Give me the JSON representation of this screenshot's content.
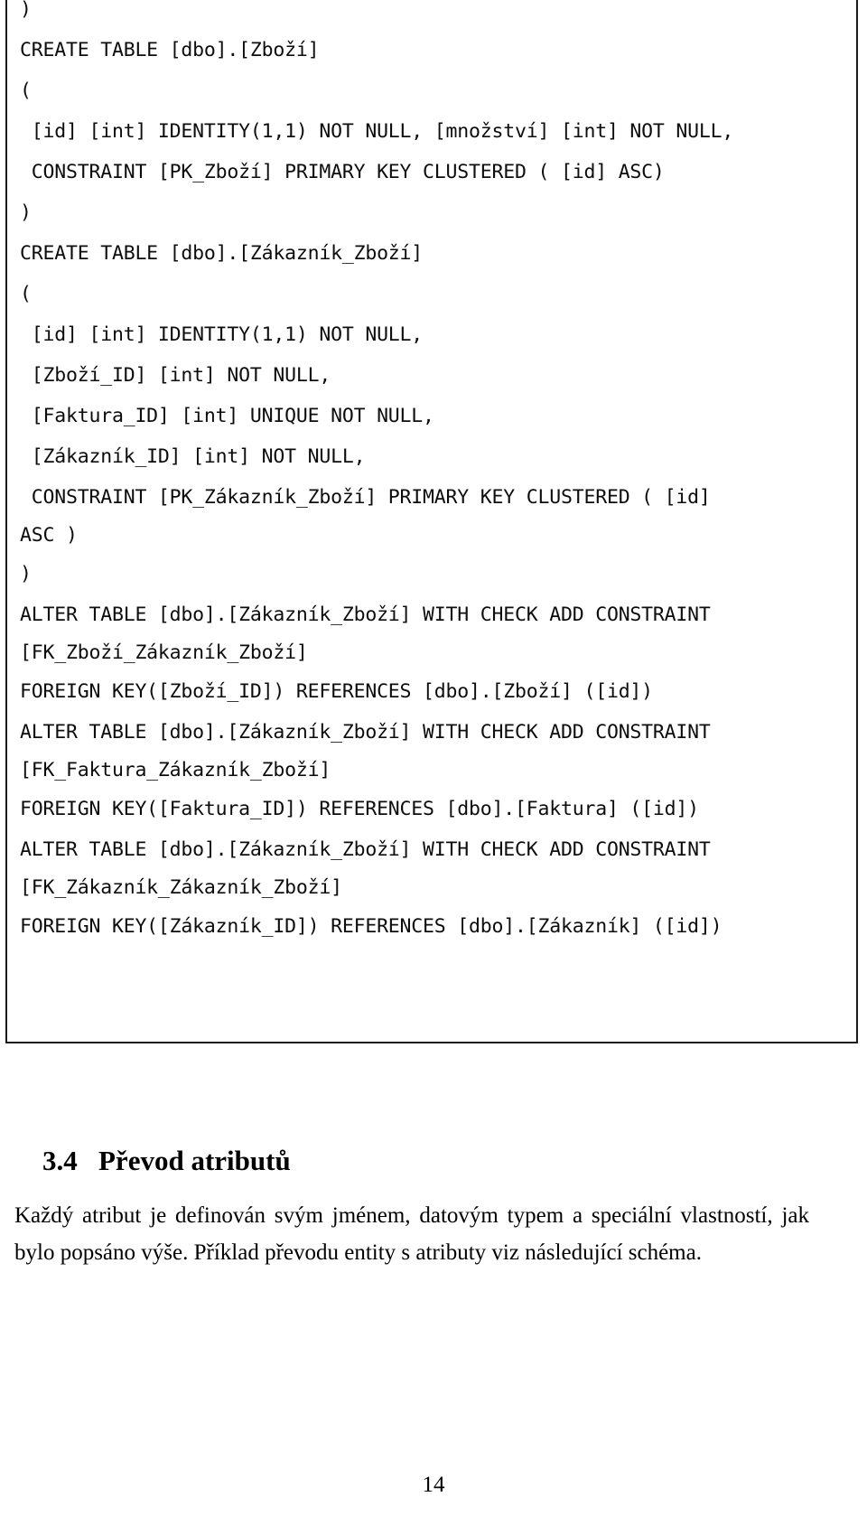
{
  "document": {
    "page_number": "14",
    "language": "cs"
  },
  "code_block": {
    "language": "sql",
    "lines": [
      {
        "text": ")",
        "cont": false
      },
      {
        "text": "CREATE TABLE [dbo].[Zboží]",
        "cont": false
      },
      {
        "text": "(",
        "cont": false
      },
      {
        "text": " [id] [int] IDENTITY(1,1) NOT NULL, [množství] [int] NOT NULL,",
        "cont": false
      },
      {
        "text": " CONSTRAINT [PK_Zboží] PRIMARY KEY CLUSTERED ( [id] ASC)",
        "cont": false
      },
      {
        "text": ")",
        "cont": false
      },
      {
        "text": "CREATE TABLE [dbo].[Zákazník_Zboží]",
        "cont": false
      },
      {
        "text": "(",
        "cont": false
      },
      {
        "text": " [id] [int] IDENTITY(1,1) NOT NULL,",
        "cont": false
      },
      {
        "text": " [Zboží_ID] [int] NOT NULL,",
        "cont": false
      },
      {
        "text": " [Faktura_ID] [int] UNIQUE NOT NULL,",
        "cont": false
      },
      {
        "text": " [Zákazník_ID] [int] NOT NULL,",
        "cont": false
      },
      {
        "text": " CONSTRAINT [PK_Zákazník_Zboží] PRIMARY KEY CLUSTERED ( [id]",
        "cont": false
      },
      {
        "text": "ASC )",
        "cont": true
      },
      {
        "text": ")",
        "cont": false
      },
      {
        "text": "ALTER TABLE [dbo].[Zákazník_Zboží] WITH CHECK ADD CONSTRAINT",
        "cont": false
      },
      {
        "text": "[FK_Zboží_Zákazník_Zboží]",
        "cont": true
      },
      {
        "text": "FOREIGN KEY([Zboží_ID]) REFERENCES [dbo].[Zboží] ([id])",
        "cont": false
      },
      {
        "text": "ALTER TABLE [dbo].[Zákazník_Zboží] WITH CHECK ADD CONSTRAINT",
        "cont": false
      },
      {
        "text": "[FK_Faktura_Zákazník_Zboží]",
        "cont": true
      },
      {
        "text": "FOREIGN KEY([Faktura_ID]) REFERENCES [dbo].[Faktura] ([id])",
        "cont": false
      },
      {
        "text": "ALTER TABLE [dbo].[Zákazník_Zboží] WITH CHECK ADD CONSTRAINT",
        "cont": false
      },
      {
        "text": "[FK_Zákazník_Zákazník_Zboží]",
        "cont": true
      },
      {
        "text": "FOREIGN KEY([Zákazník_ID]) REFERENCES [dbo].[Zákazník] ([id])",
        "cont": false
      }
    ]
  },
  "section": {
    "number": "3.4",
    "title": "Převod atributů",
    "paragraph": "Každý atribut je definován svým jménem, datovým typem a speciální vlastností, jak bylo popsáno výše. Příklad převodu entity s atributy viz následující schéma."
  }
}
